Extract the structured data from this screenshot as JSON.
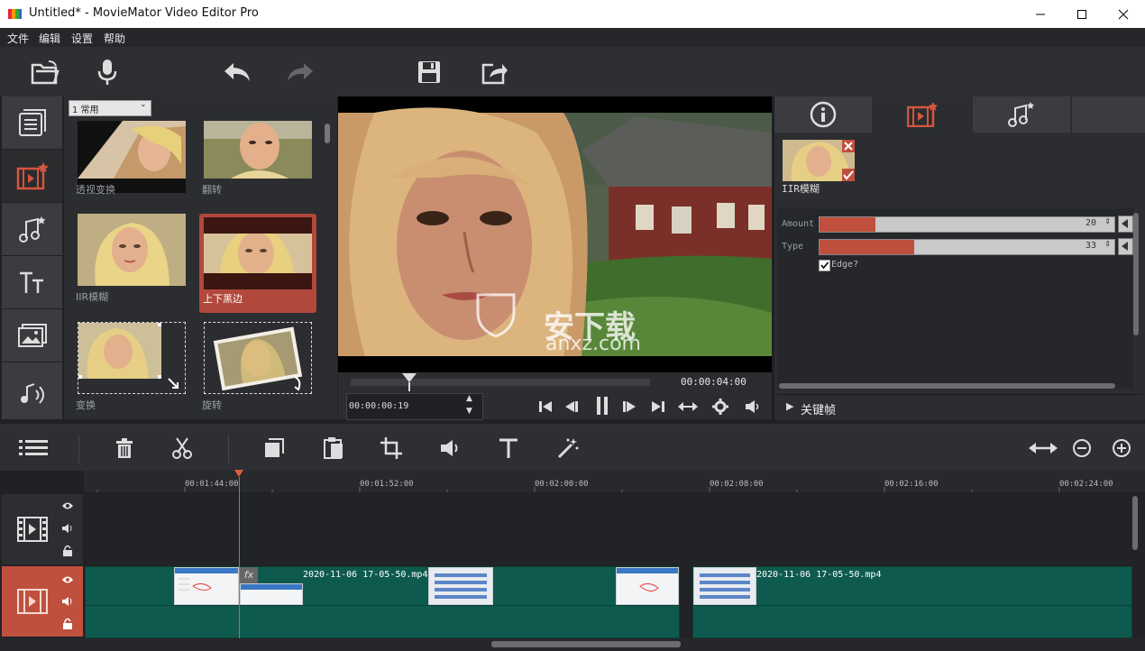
{
  "window": {
    "title": "Untitled* - MovieMator Video Editor Pro"
  },
  "menu": [
    "文件",
    "编辑",
    "设置",
    "帮助"
  ],
  "filter_panel": {
    "category_select": "1 常用",
    "items": [
      {
        "label": "透视变换"
      },
      {
        "label": "翻转"
      },
      {
        "label": "IIR模糊"
      },
      {
        "label": "上下黑边",
        "selected": true
      },
      {
        "label": "变换"
      },
      {
        "label": "旋转"
      }
    ]
  },
  "player": {
    "current_time": "00:00:00:19",
    "total_time": "00:00:04:00",
    "watermark_text": "安下载",
    "watermark_sub": "anxz.com"
  },
  "properties": {
    "applied_filter_label": "IIR模糊",
    "params": [
      {
        "label": "Amount",
        "value": "20",
        "fill": 0.19
      },
      {
        "label": "Type",
        "value": "33",
        "fill": 0.32
      }
    ],
    "checkbox_label": "Edge?",
    "checkbox_checked": true,
    "keyframes_label": "关键帧"
  },
  "timeline": {
    "ruler_ticks": [
      "00:01:44:00",
      "00:01:52:00",
      "00:02:00:00",
      "00:02:08:00",
      "00:02:16:00",
      "00:02:24:00"
    ],
    "clip_names": [
      "2020-11-06 17-05-50.mp4",
      "2020-11-06 17-05-50.mp4"
    ],
    "fx_badge": "fx"
  },
  "colors": {
    "accent": "#c0503e",
    "clip": "#0f5a4e",
    "panel": "#2b2d30"
  }
}
